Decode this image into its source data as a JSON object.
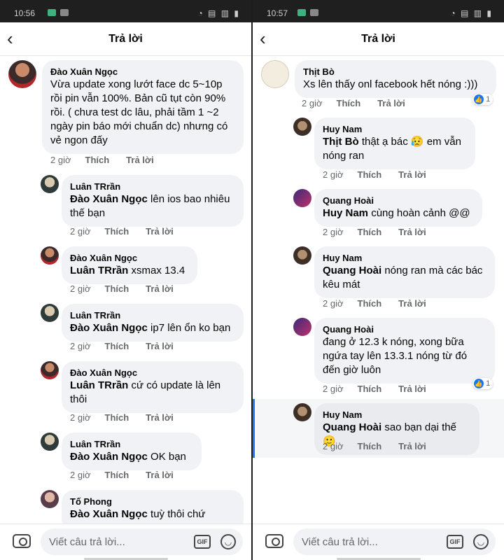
{
  "left": {
    "status_time": "10:56",
    "header": {
      "title": "Trả lời"
    },
    "comments": [
      {
        "name": "Đào Xuân Ngọc",
        "tag": "",
        "text": "Vừa update xong lướt face dc 5~10p rồi pin vẫn 100%. Bản cũ tụt còn 90% rồi. ( chưa test dc lâu, phải tầm 1 ~2 ngày pin báo mới chuẩn dc) nhưng có vẻ ngon đấy",
        "time": "2 giờ",
        "like": "Thích",
        "reply": "Trả lời"
      },
      {
        "name": "Luân TRrần",
        "tag": "Đào Xuân Ngọc",
        "text": " lên ios bao nhiêu thế bạn",
        "time": "2 giờ",
        "like": "Thích",
        "reply": "Trả lời"
      },
      {
        "name": "Đào Xuân Ngọc",
        "tag": "Luân TRrần",
        "text": " xsmax 13.4",
        "time": "2 giờ",
        "like": "Thích",
        "reply": "Trả lời"
      },
      {
        "name": "Luân TRrần",
        "tag": "Đào Xuân Ngọc",
        "text": " ip7 lên ổn ko bạn",
        "time": "2 giờ",
        "like": "Thích",
        "reply": "Trả lời"
      },
      {
        "name": "Đào Xuân Ngọc",
        "tag": "Luân TRrần",
        "text": "  cứ có update là lên thôi",
        "time": "2 giờ",
        "like": "Thích",
        "reply": "Trả lời"
      },
      {
        "name": "Luân TRrần",
        "tag": "Đào Xuân Ngọc",
        "text": " OK bạn",
        "time": "2 giờ",
        "like": "Thích",
        "reply": "Trả lời"
      },
      {
        "name": "Tố Phong",
        "tag": "Đào Xuân Ngọc",
        "text": " tuỳ thôi chứ",
        "time": "",
        "like": "",
        "reply": ""
      }
    ],
    "composer": {
      "placeholder": "Viết câu trả lời...",
      "gif_label": "GIF"
    }
  },
  "right": {
    "status_time": "10:57",
    "header": {
      "title": "Trả lời"
    },
    "comments": [
      {
        "name": "Thịt Bò",
        "tag": "",
        "text": "Xs lên thấy onl facebook hết nóng :)))",
        "time": "2 giờ",
        "like": "Thích",
        "reply": "Trả lời",
        "reactions": "1"
      },
      {
        "name": "Huy Nam",
        "tag": "Thịt Bò",
        "text": " thật ạ bác 😥 em vẫn nóng ran",
        "time": "2 giờ",
        "like": "Thích",
        "reply": "Trả lời"
      },
      {
        "name": "Quang Hoài",
        "tag": "Huy Nam",
        "text": " cùng hoàn cảnh @@",
        "time": "2 giờ",
        "like": "Thích",
        "reply": "Trả lời"
      },
      {
        "name": "Huy Nam",
        "tag": "Quang Hoài",
        "text": " nóng ran mà các bác kêu mát",
        "time": "2 giờ",
        "like": "Thích",
        "reply": "Trả lời"
      },
      {
        "name": "Quang Hoài",
        "tag": "",
        "text": "đang ở 12.3 k nóng, xong bữa ngứa tay lên 13.3.1 nóng từ đó đến giờ luôn",
        "time": "2 giờ",
        "like": "Thích",
        "reply": "Trả lời",
        "reactions": "1"
      },
      {
        "name": "Huy Nam",
        "tag": "Quang Hoài",
        "text": " sao bạn dại thế 🙂",
        "time": "2 giờ",
        "like": "Thích",
        "reply": "Trả lời"
      }
    ],
    "composer": {
      "placeholder": "Viết câu trả lời...",
      "gif_label": "GIF"
    }
  },
  "colors": {
    "accent": "#1877f2",
    "bubble": "#f0f2f5",
    "meta": "#65676b"
  }
}
